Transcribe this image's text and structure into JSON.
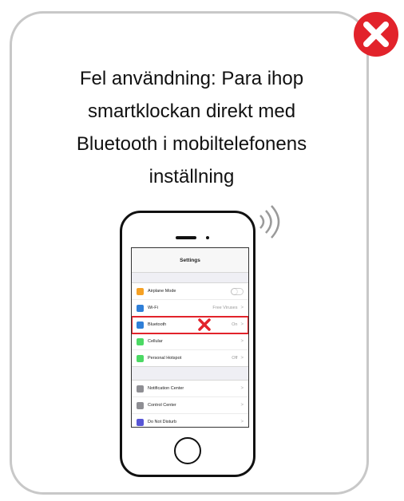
{
  "message": {
    "lines": [
      "Fel användning: Para ihop",
      "smartklockan direkt med",
      "Bluetooth i mobiltelefonens",
      "inställning"
    ]
  },
  "phone_screen": {
    "title": "Settings",
    "group1": [
      {
        "label": "Airplane Mode",
        "value": "",
        "icon_color": "#f6a124",
        "control": "toggle"
      },
      {
        "label": "Wi-Fi",
        "value": "Free Viruses",
        "icon_color": "#2f7fd8",
        "control": "chevron"
      },
      {
        "label": "Bluetooth",
        "value": "On",
        "icon_color": "#2f7fd8",
        "control": "chevron",
        "highlighted": true
      },
      {
        "label": "Cellular",
        "value": "",
        "icon_color": "#4cd964",
        "control": "chevron"
      },
      {
        "label": "Personal Hotspot",
        "value": "Off",
        "icon_color": "#4cd964",
        "control": "chevron"
      }
    ],
    "group2": [
      {
        "label": "Notification Center",
        "value": "",
        "icon_color": "#8e8e93",
        "control": "chevron"
      },
      {
        "label": "Control Center",
        "value": "",
        "icon_color": "#8e8e93",
        "control": "chevron"
      },
      {
        "label": "Do Not Disturb",
        "value": "",
        "icon_color": "#5856d6",
        "control": "chevron"
      }
    ]
  },
  "icons": {
    "error_badge": "red-x-circle-icon",
    "signal": "wireless-signal-icon",
    "wrong_mark": "red-x-icon"
  },
  "colors": {
    "error_red": "#e2232b",
    "card_border": "#c8c8c8"
  }
}
